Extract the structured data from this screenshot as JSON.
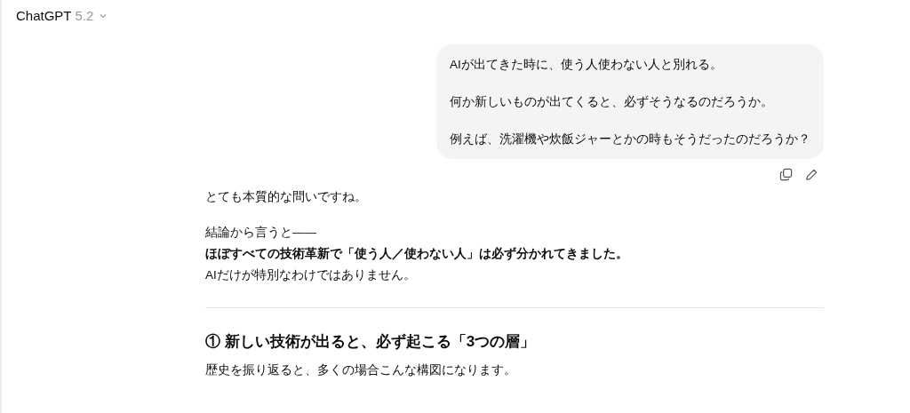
{
  "header": {
    "title": "ChatGPT",
    "version": "5.2"
  },
  "user_message": {
    "paragraphs": [
      "AIが出てきた時に、使う人使わない人と別れる。",
      "何か新しいものが出てくると、必ずそうなるのだろうか。",
      "例えば、洗濯機や炊飯ジャーとかの時もそうだったのだろうか？"
    ]
  },
  "assistant_message": {
    "blocks": [
      {
        "kind": "paragraph",
        "lines": [
          {
            "text": "とても本質的な問いですね。",
            "bold": false
          }
        ]
      },
      {
        "kind": "paragraph",
        "lines": [
          {
            "text": "結論から言うと――",
            "bold": false
          },
          {
            "text": "ほぼすべての技術革新で「使う人／使わない人」は必ず分かれてきました。",
            "bold": true
          },
          {
            "text": "AIだけが特別なわけではありません。",
            "bold": false
          }
        ]
      },
      {
        "kind": "divider"
      },
      {
        "kind": "heading",
        "text": "① 新しい技術が出ると、必ず起こる「3つの層」"
      },
      {
        "kind": "paragraph",
        "lines": [
          {
            "text": "歴史を振り返ると、多くの場合こんな構図になります。",
            "bold": false
          }
        ]
      }
    ]
  }
}
